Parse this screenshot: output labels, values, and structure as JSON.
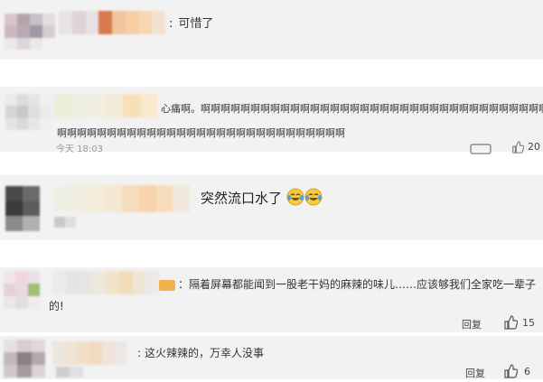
{
  "comments": [
    {
      "text": "可惜了",
      "prefix": ":"
    },
    {
      "text_line1": "心痛啊。啊啊啊啊啊啊啊啊啊啊啊啊啊啊啊啊啊啊啊啊啊啊啊啊啊啊啊啊啊啊啊啊啊啊啊啊啊",
      "text_line2": "啊啊啊啊啊啊啊啊啊啊啊啊啊啊啊啊啊啊啊啊啊啊啊啊啊啊啊啊啊",
      "time": "今天 18:03",
      "likes": "20"
    },
    {
      "text": "突然流口水了"
    },
    {
      "text_line1": "：隔着屏幕都能闻到一股老干妈的麻辣的味儿……应该够我们全家吃一辈子",
      "text_line2": "的!",
      "reply_label": "回复",
      "likes": "15"
    },
    {
      "prefix": ":",
      "text": "这火辣辣的，万幸人没事",
      "reply_label": "回复",
      "likes": "6"
    }
  ],
  "colors": {
    "band": "#f2f2f2",
    "emoji_face": "#f7c94a",
    "emoji_tear": "#4aa3e0"
  },
  "icons": {
    "like": "thumbs-up-icon",
    "comment": "comment-icon",
    "emoji": "crying-laughing-emoji"
  }
}
